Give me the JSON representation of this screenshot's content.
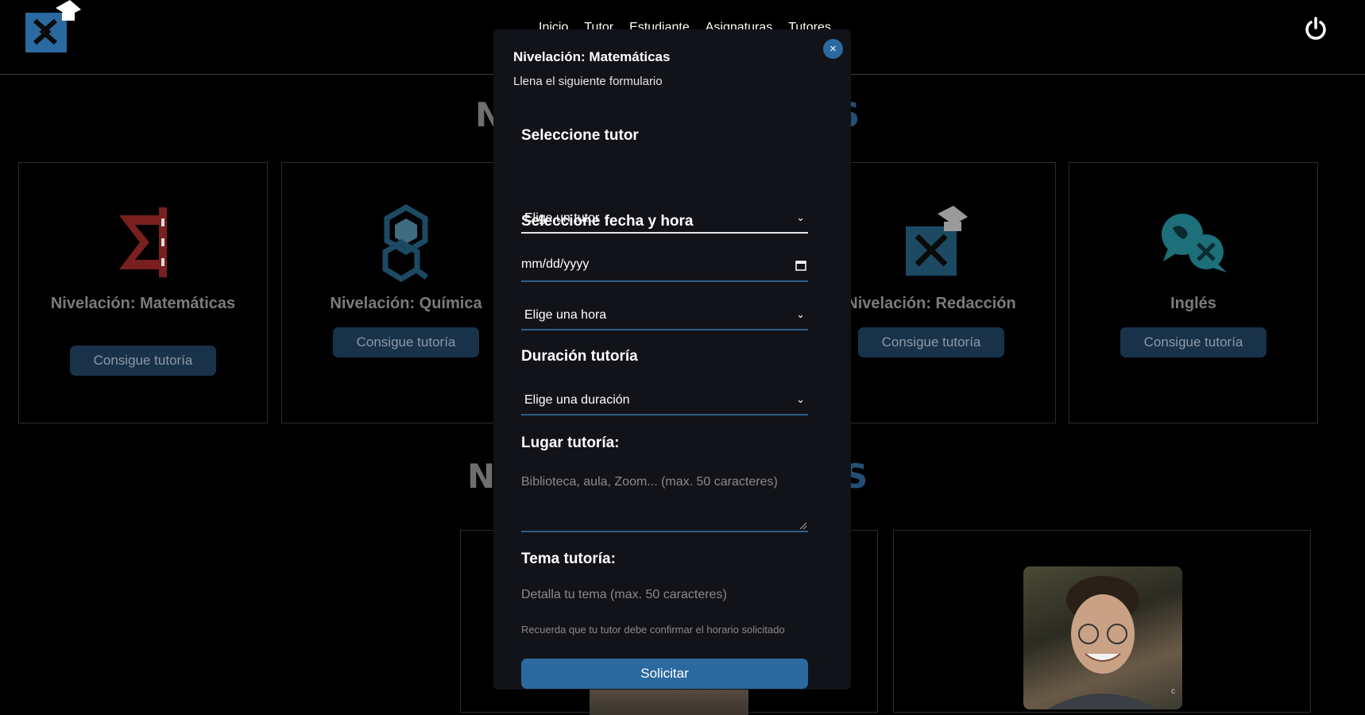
{
  "nav": {
    "items": [
      "Inicio",
      "Tutor",
      "Estudiante",
      "Asignaturas",
      "Tutores"
    ],
    "power_icon": "power-icon"
  },
  "background": {
    "section_title_1": {
      "left": "N",
      "right": "S"
    },
    "section_title_2": {
      "left": "NU",
      "right": "S"
    },
    "cards": [
      {
        "title": "Nivelación: Matemáticas",
        "button": "Consigue tutoría",
        "icon": "math-sigma-icon"
      },
      {
        "title": "Nivelación: Química",
        "button": "Consigue tutoría",
        "icon": "chemistry-icon"
      },
      {
        "title": "Nivelación: Redacción",
        "button": "Consigue tutoría",
        "icon": "writing-logo-icon"
      },
      {
        "title": "Inglés",
        "button": "Consigue tutoría",
        "icon": "english-globe-icon"
      }
    ],
    "tutor_photo_badge": "c"
  },
  "modal": {
    "title": "Nivelación: Matemáticas",
    "subtitle": "Llena el siguiente formulario",
    "close_label": "×",
    "tutor_label": "Seleccione tutor",
    "tutor_select": "Elige un tutor",
    "datetime_label": "Seleccione fecha y hora",
    "date_placeholder": "mm/dd/yyyy",
    "hour_select": "Elige una hora",
    "duration_label": "Duración tutoría",
    "duration_select": "Elige una duración",
    "place_label": "Lugar tutoría:",
    "place_placeholder": "Biblioteca, aula, Zoom... (max. 50 caracteres)",
    "topic_label": "Tema tutoría:",
    "topic_placeholder": "Detalla tu tema (max. 50 caracteres)",
    "note": "Recuerda que tu tutor debe confirmar el horario solicitado",
    "submit": "Solicitar"
  },
  "colors": {
    "accent": "#2a6aa0",
    "modal_bg": "#121318",
    "card_button_bg": "#183249"
  }
}
